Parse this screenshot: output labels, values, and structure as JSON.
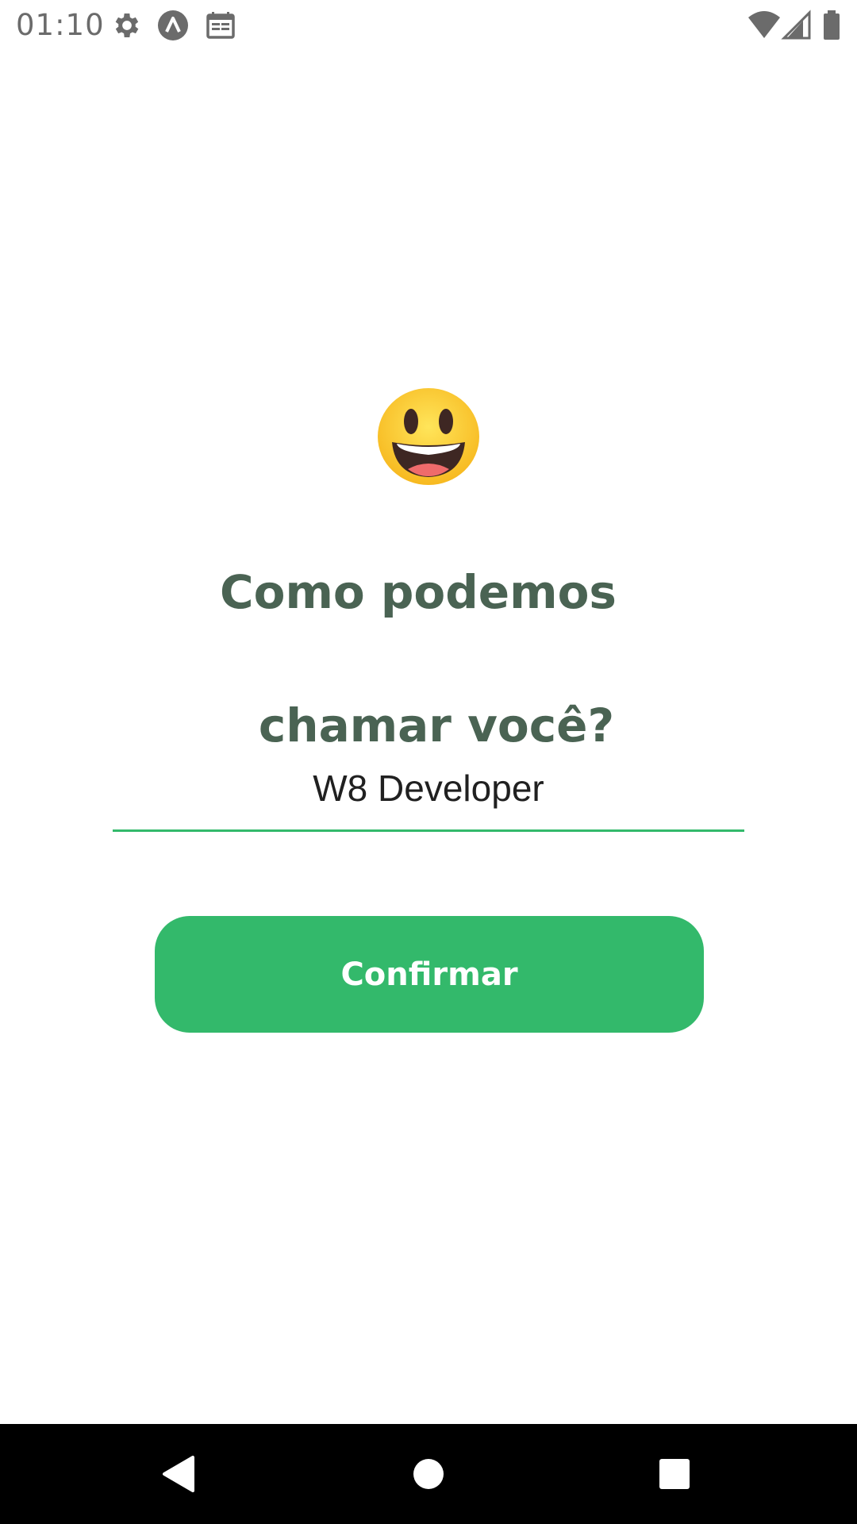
{
  "status_bar": {
    "time": "01:10",
    "icons": [
      "settings-icon",
      "a-logo-icon",
      "calendar-icon",
      "wifi-icon",
      "signal-icon",
      "battery-icon"
    ]
  },
  "content": {
    "emoji": "smiley-face",
    "title_line1": "Como podemos",
    "title_line2": "chamar você?",
    "name_value": "W8 Developer",
    "confirm_label": "Confirmar"
  },
  "navigation": {
    "icons": [
      "back-icon",
      "home-icon",
      "recents-icon"
    ]
  },
  "colors": {
    "accent": "#33b96b",
    "title": "#4a6353",
    "status_text": "#6b6b6b"
  }
}
